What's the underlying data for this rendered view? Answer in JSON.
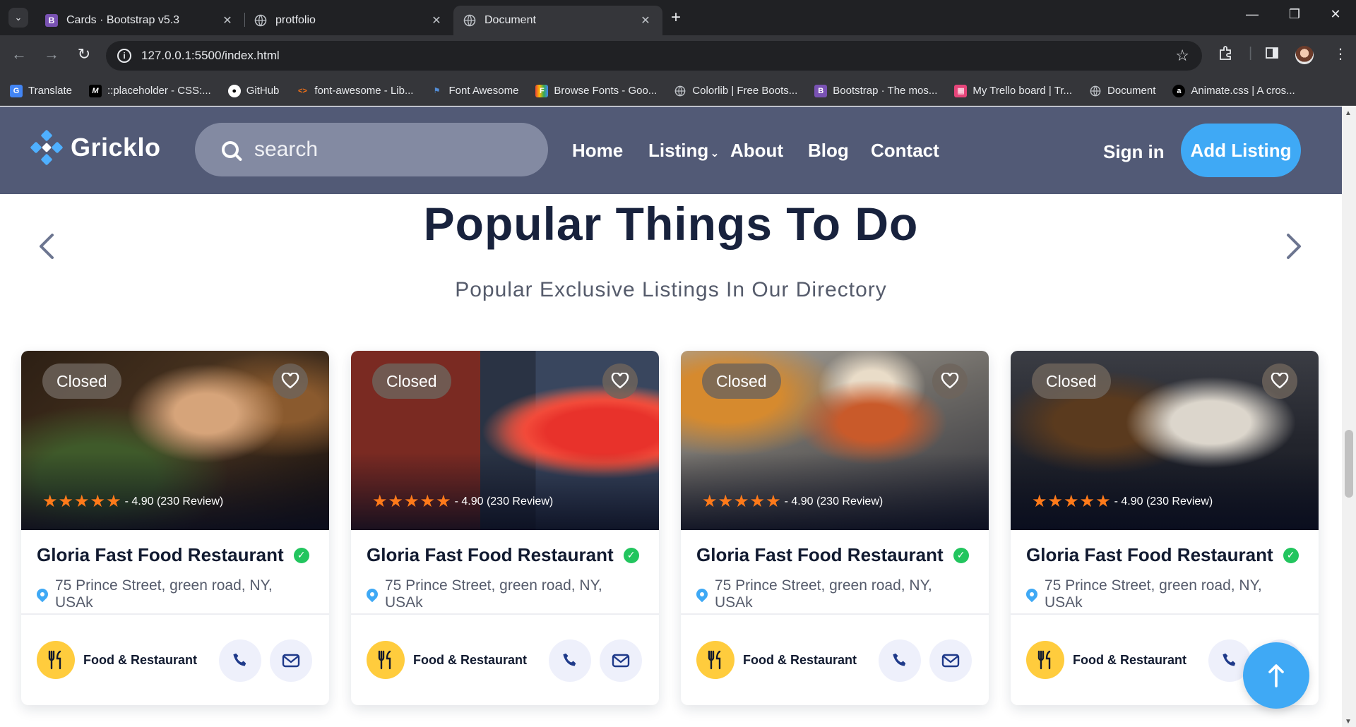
{
  "browser": {
    "tabs": [
      {
        "title": "Cards · Bootstrap v5.3",
        "favicon": "bootstrap-icon",
        "active": false
      },
      {
        "title": "protfolio",
        "favicon": "globe-icon",
        "active": false
      },
      {
        "title": "Document",
        "favicon": "globe-icon",
        "active": true
      }
    ],
    "url": "127.0.0.1:5500/index.html",
    "bookmarks": [
      {
        "label": "Translate",
        "icon": "google-translate-icon"
      },
      {
        "label": "::placeholder - CSS:...",
        "icon": "mdn-icon"
      },
      {
        "label": "GitHub",
        "icon": "github-icon"
      },
      {
        "label": "font-awesome - Lib...",
        "icon": "code-icon"
      },
      {
        "label": "Font Awesome",
        "icon": "flag-icon"
      },
      {
        "label": "Browse Fonts - Goo...",
        "icon": "google-fonts-icon"
      },
      {
        "label": "Colorlib | Free Boots...",
        "icon": "globe-icon"
      },
      {
        "label": "Bootstrap · The mos...",
        "icon": "bootstrap-icon"
      },
      {
        "label": "My Trello board | Tr...",
        "icon": "trello-icon"
      },
      {
        "label": "Document",
        "icon": "globe-icon"
      },
      {
        "label": "Animate.css | A cros...",
        "icon": "animate-icon"
      }
    ]
  },
  "site": {
    "logo": "Gricklo",
    "search_placeholder": "search",
    "menu": [
      "Home",
      "Listing",
      "About",
      "Blog",
      "Contact"
    ],
    "signin": "Sign in",
    "add_listing": "Add Listing",
    "accent": "#3fa9f5",
    "nav_bg": "#525a76"
  },
  "section": {
    "title": "Popular Things To Do",
    "subtitle": "Popular Exclusive Listings In Our Directory"
  },
  "cards": [
    {
      "status": "Closed",
      "rating": "- 4.90 (230 Review)",
      "name": "Gloria Fast Food Restaurant",
      "address": "75 Prince Street, green road, NY, USAk",
      "category": "Food & Restaurant"
    },
    {
      "status": "Closed",
      "rating": "- 4.90 (230 Review)",
      "name": "Gloria Fast Food Restaurant",
      "address": "75 Prince Street, green road, NY, USAk",
      "category": "Food & Restaurant"
    },
    {
      "status": "Closed",
      "rating": "- 4.90 (230 Review)",
      "name": "Gloria Fast Food Restaurant",
      "address": "75 Prince Street, green road, NY, USAk",
      "category": "Food & Restaurant"
    },
    {
      "status": "Closed",
      "rating": "- 4.90 (230 Review)",
      "name": "Gloria Fast Food Restaurant",
      "address": "75 Prince Street, green road, NY, USAk",
      "category": "Food & Restaurant"
    }
  ]
}
